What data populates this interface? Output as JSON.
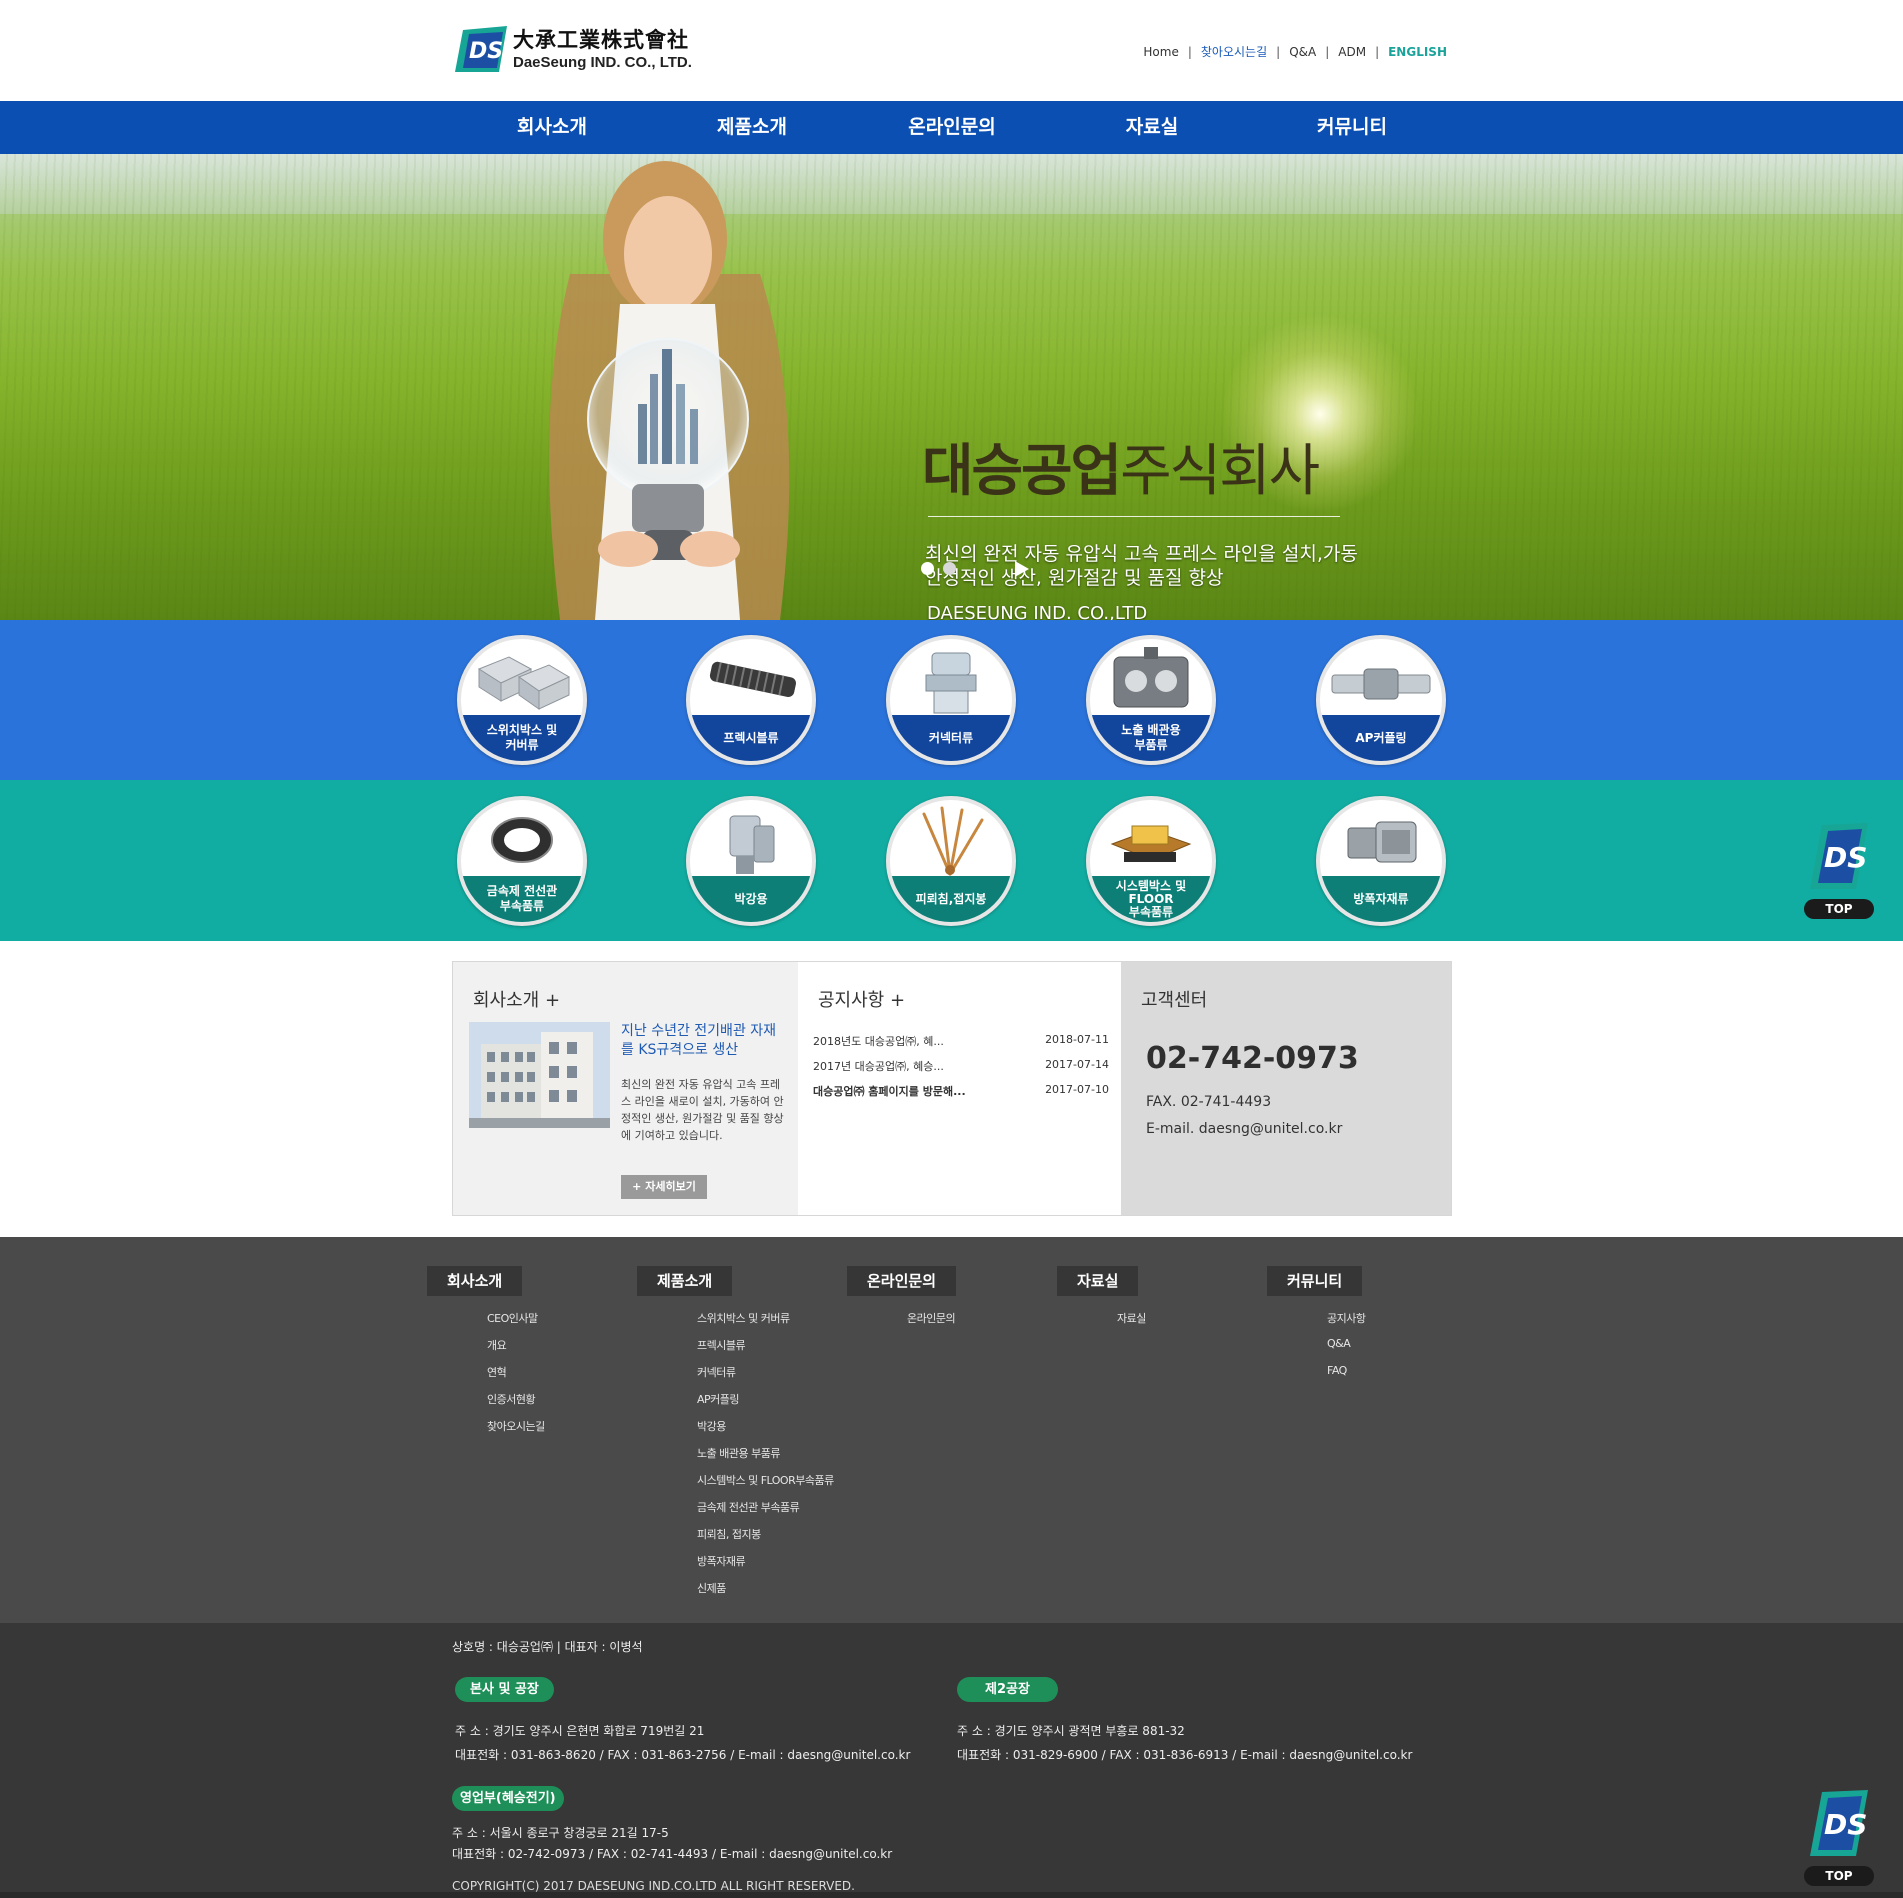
{
  "header": {
    "logo_kr": "大承工業株式會社",
    "logo_en": "DaeSeung IND. CO., LTD.",
    "util_links": [
      "Home",
      "찾아오시는길",
      "Q&A",
      "ADM",
      "ENGLISH"
    ]
  },
  "gnb": [
    "회사소개",
    "제품소개",
    "온라인문의",
    "자료실",
    "커뮤니티"
  ],
  "hero": {
    "title_bold": "대승공업",
    "title_thin": "주식회사",
    "desc_line1": "최신의 완전 자동 유압식 고속 프레스 라인을 설치,가동",
    "desc_line2": "안정적인 생산, 원가절감 및 품질 향상",
    "company": "DAESEUNG IND. CO.,LTD",
    "slide_count": 2,
    "active_slide": 1
  },
  "products_row1": [
    {
      "line1": "스위치박스 및",
      "line2": "커버류"
    },
    {
      "line1": "프렉시블류",
      "line2": ""
    },
    {
      "line1": "커넥터류",
      "line2": ""
    },
    {
      "line1": "노출 배관용",
      "line2": "부품류"
    },
    {
      "line1": "AP커플링",
      "line2": ""
    }
  ],
  "products_row2": [
    {
      "line1": "금속제 전선관",
      "line2": "부속품류"
    },
    {
      "line1": "박강용",
      "line2": ""
    },
    {
      "line1": "피뢰침,접지봉",
      "line2": ""
    },
    {
      "line1": "시스템박스 및",
      "line2": "FLOOR",
      "line3": "부속품류"
    },
    {
      "line1": "방폭자재류",
      "line2": ""
    }
  ],
  "about": {
    "title": "회사소개 +",
    "headline": "지난 수년간 전기배관 자재를 KS규격으로 생산",
    "body": "최신의 완전 자동 유압식 고속 프레스 라인을 새로이 설치, 가동하여 안정적인 생산, 원가절감 및 품질 향상에 기여하고 있습니다.",
    "more_button": "+ 자세히보기"
  },
  "notices": {
    "title": "공지사항 +",
    "items": [
      {
        "title": "2018년도 대승공업㈜, 혜...",
        "date": "2018-07-11"
      },
      {
        "title": "2017년 대승공업㈜, 혜승...",
        "date": "2017-07-14"
      },
      {
        "title": "대승공업㈜ 홈페이지를 방문해...",
        "date": "2017-07-10"
      }
    ]
  },
  "customer_center": {
    "title": "고객센터",
    "tel": "02-742-0973",
    "fax": "FAX. 02-741-4493",
    "email": "E-mail. daesng@unitel.co.kr"
  },
  "sitemap": [
    {
      "head": "회사소개",
      "items": [
        "CEO인사말",
        "개요",
        "연혁",
        "인증서현황",
        "찾아오시는길"
      ]
    },
    {
      "head": "제품소개",
      "items": [
        "스위치박스 및 커버류",
        "프렉시블류",
        "커넥터류",
        "AP커플링",
        "박강용",
        "노출 배관용 부품류",
        "시스템박스 및 FLOOR부속품류",
        "금속제 전선관 부속품류",
        "피뢰침, 접지봉",
        "방폭자재류",
        "신제품"
      ]
    },
    {
      "head": "온라인문의",
      "items": [
        "온라인문의"
      ]
    },
    {
      "head": "자료실",
      "items": [
        "자료실"
      ]
    },
    {
      "head": "커뮤니티",
      "items": [
        "공지사항",
        "Q&A",
        "FAQ"
      ]
    }
  ],
  "footer": {
    "company": "상호명 : 대승공업㈜  |  대표자 : 이병석",
    "hq_label": "본사 및 공장",
    "hq_addr": "주    소 : 경기도 양주시 은현면 화합로 719번길 21",
    "hq_tel": "대표전화 : 031-863-8620 / FAX : 031-863-2756 / E-mail : daesng@unitel.co.kr",
    "f2_label": "제2공장",
    "f2_addr": "주    소 : 경기도 양주시 광적면 부흥로 881-32",
    "f2_tel": "대표전화 : 031-829-6900 / FAX : 031-836-6913 / E-mail : daesng@unitel.co.kr",
    "sales_label": "영업부(혜승전기)",
    "sales_addr": "주    소 : 서울시 종로구 창경궁로 21길 17-5",
    "sales_tel": "대표전화 : 02-742-0973 / FAX : 02-741-4493 / E-mail : daesng@unitel.co.kr",
    "copyright": "COPYRIGHT(C) 2017 DAESEUNG IND.CO.LTD ALL RIGHT RESERVED."
  },
  "top_button": "TOP",
  "colors": {
    "gnb": "#0b4fb3",
    "row_blue": "#2a73db",
    "row_teal": "#12ada2",
    "footer": "#4a4a4a",
    "pill": "#1e8f58"
  }
}
